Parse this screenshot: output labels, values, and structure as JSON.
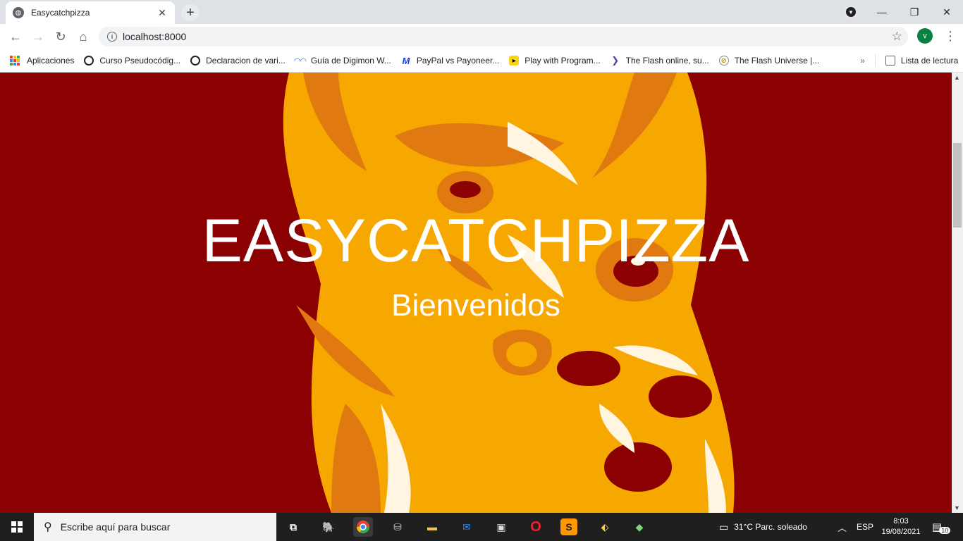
{
  "browser": {
    "tab_title": "Easycatchpizza",
    "tab_close": "✕",
    "new_tab": "+",
    "minimize": "—",
    "restore": "❐",
    "close": "✕",
    "url": "localhost:8000",
    "avatar_letter": "v"
  },
  "bookmarks": {
    "items": [
      {
        "label": "Aplicaciones",
        "icon": "apps-grid-icon"
      },
      {
        "label": "Curso Pseudocódig...",
        "icon": "github-icon"
      },
      {
        "label": "Declaracion de vari...",
        "icon": "github-icon"
      },
      {
        "label": "Guía de Digimon W...",
        "icon": "digimon-icon"
      },
      {
        "label": "PayPal vs Payoneer...",
        "icon": "m-icon"
      },
      {
        "label": "Play with Program...",
        "icon": "play-icon"
      },
      {
        "label": "The Flash online, su...",
        "icon": "arrow-icon"
      },
      {
        "label": "The Flash Universe |...",
        "icon": "compass-icon"
      }
    ],
    "more": "»",
    "reading_list": "Lista de lectura"
  },
  "page": {
    "title": "EASYCATCHPIZZA",
    "subtitle": "Bienvenidos",
    "background_color": "#8b0000"
  },
  "taskbar": {
    "search_placeholder": "Escribe aquí para buscar",
    "weather": "31°C  Parc. soleado",
    "language": "ESP",
    "time": "8:03",
    "date": "19/08/2021",
    "notification_count": "10"
  }
}
